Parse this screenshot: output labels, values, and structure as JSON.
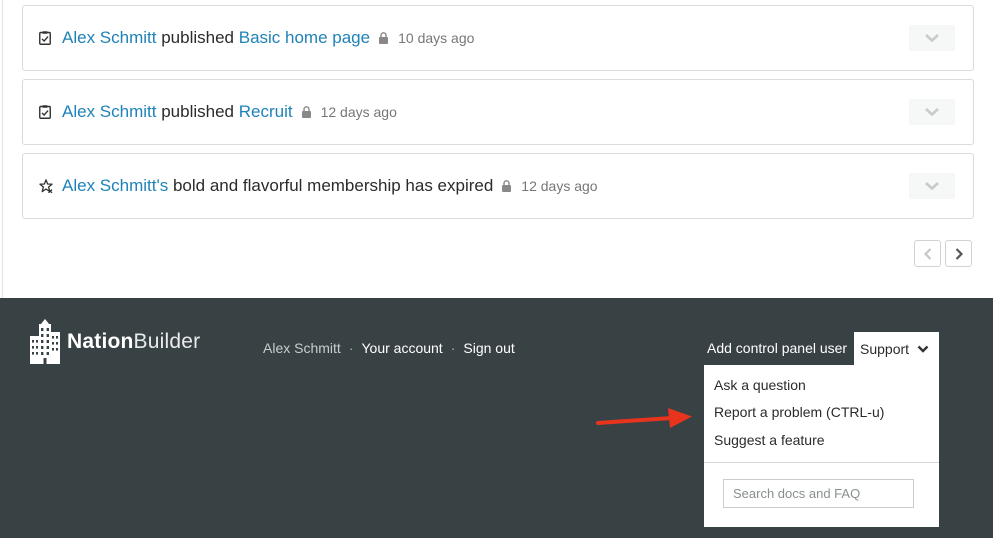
{
  "activity": [
    {
      "icon": "checklist-icon",
      "actor": "Alex Schmitt",
      "verb": "published",
      "object": "Basic home page",
      "time": "10 days ago"
    },
    {
      "icon": "checklist-icon",
      "actor": "Alex Schmitt",
      "verb": "published",
      "object": "Recruit",
      "time": "12 days ago"
    },
    {
      "icon": "star-icon",
      "actor": "Alex Schmitt's",
      "rest": "bold and flavorful membership has expired",
      "time": "12 days ago"
    }
  ],
  "footer": {
    "brand_first": "Nation",
    "brand_second": "Builder",
    "user_name": "Alex Schmitt",
    "separator": "·",
    "your_account": "Your account",
    "sign_out": "Sign out",
    "add_control_panel_user": "Add control panel user",
    "support_label": "Support"
  },
  "support_menu": {
    "items": [
      "Ask a question",
      "Report a problem (CTRL-u)",
      "Suggest a feature"
    ],
    "search_placeholder": "Search docs and FAQ"
  },
  "colors": {
    "link": "#1f82b8",
    "footer_bg": "#384144",
    "annotation_arrow": "#e8341c"
  }
}
